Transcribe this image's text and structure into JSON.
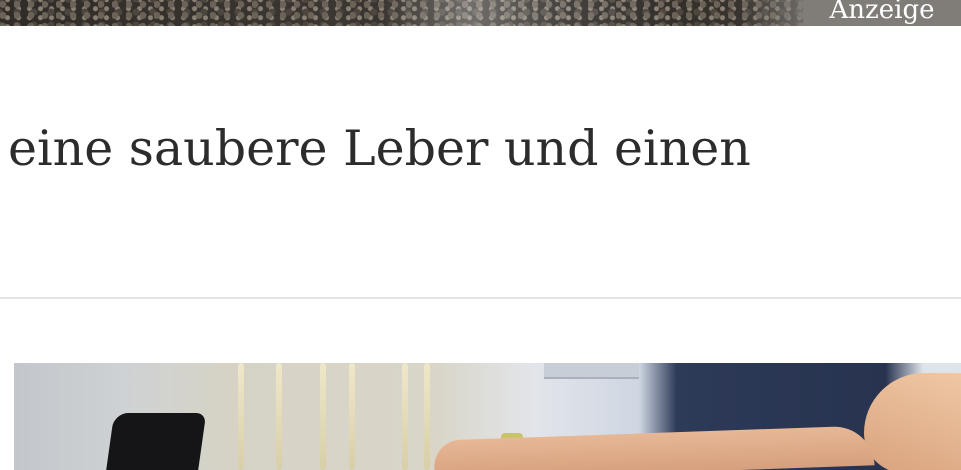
{
  "ad": {
    "label": "Anzeige"
  },
  "article": {
    "headline": "eine saubere Leber und einen"
  },
  "colors": {
    "text": "#2c2c2c",
    "ad_badge_bg": "#807c78",
    "divider": "#e4e4e4"
  }
}
